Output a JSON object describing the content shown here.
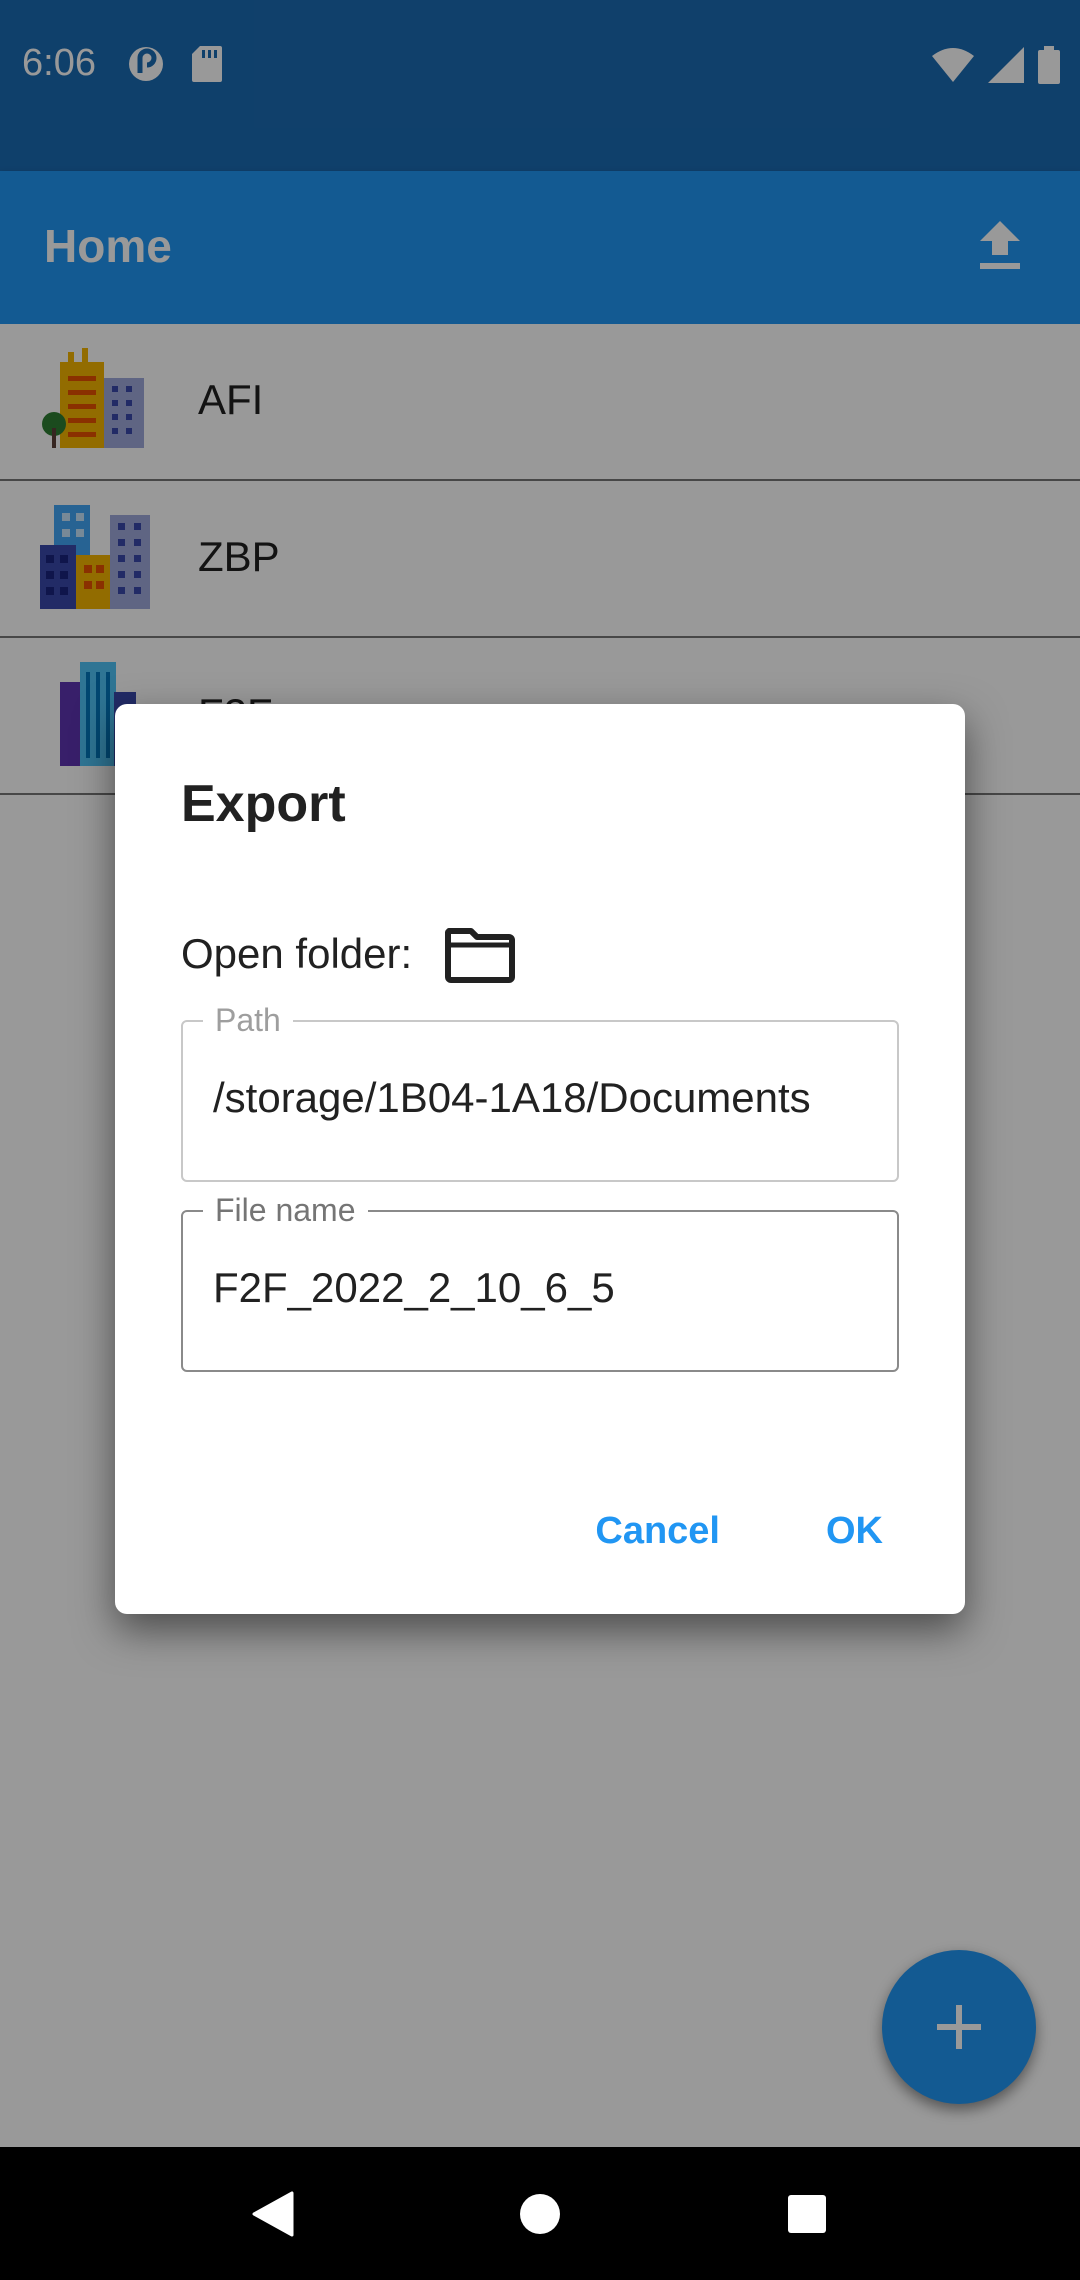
{
  "status_bar": {
    "time": "6:06",
    "icons": [
      "pocket-casts-icon",
      "sd-card-icon",
      "wifi-icon",
      "signal-icon",
      "battery-icon"
    ]
  },
  "app_bar": {
    "title": "Home",
    "action_icon": "upload-icon"
  },
  "list": {
    "items": [
      {
        "label": "AFI",
        "icon": "building-icon"
      },
      {
        "label": "ZBP",
        "icon": "building-icon"
      },
      {
        "label": "F2F",
        "icon": "building-icon"
      }
    ]
  },
  "dialog": {
    "title": "Export",
    "open_folder_label": "Open folder:",
    "folder_icon": "folder-icon",
    "path": {
      "label": "Path",
      "value": "/storage/1B04-1A18/Documents"
    },
    "file_name": {
      "label": "File name",
      "value": "F2F_2022_2_10_6_5"
    },
    "cancel_label": "Cancel",
    "ok_label": "OK"
  },
  "fab": {
    "icon": "plus-icon"
  },
  "nav_bar": {
    "icons": [
      "back-icon",
      "home-icon",
      "recents-icon"
    ]
  },
  "colors": {
    "primary": "#2196f3",
    "status_bar": "#1a6bb3",
    "scrim": "rgba(0,0,0,0.4)"
  }
}
